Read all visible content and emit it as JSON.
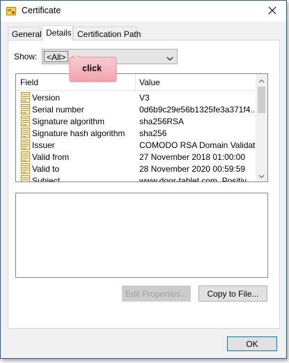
{
  "window": {
    "title": "Certificate",
    "colors": {
      "frame": "#2b579a",
      "ok_border": "#0078d7"
    }
  },
  "tabs": [
    {
      "label": "General"
    },
    {
      "label": "Details",
      "active": true
    },
    {
      "label": "Certification Path"
    }
  ],
  "show": {
    "label": "Show:",
    "value": "<All>"
  },
  "list": {
    "headers": {
      "field": "Field",
      "value": "Value"
    },
    "rows": [
      {
        "field": "Version",
        "value": "V3"
      },
      {
        "field": "Serial number",
        "value": "0d6b9c29e56b1325fe3a371f4..."
      },
      {
        "field": "Signature algorithm",
        "value": "sha256RSA"
      },
      {
        "field": "Signature hash algorithm",
        "value": "sha256"
      },
      {
        "field": "Issuer",
        "value": "COMODO RSA Domain Validati..."
      },
      {
        "field": "Valid from",
        "value": "27 November 2018 01:00:00"
      },
      {
        "field": "Valid to",
        "value": "28 November 2020 00:59:59"
      },
      {
        "field": "Subject",
        "value": "www.door-tablet.com, Positiv..."
      }
    ]
  },
  "buttons": {
    "edit_properties": "Edit Properties...",
    "copy_to_file": "Copy to File...",
    "ok": "OK"
  },
  "annotation": {
    "text": "click",
    "color": "#f7b8bf"
  }
}
